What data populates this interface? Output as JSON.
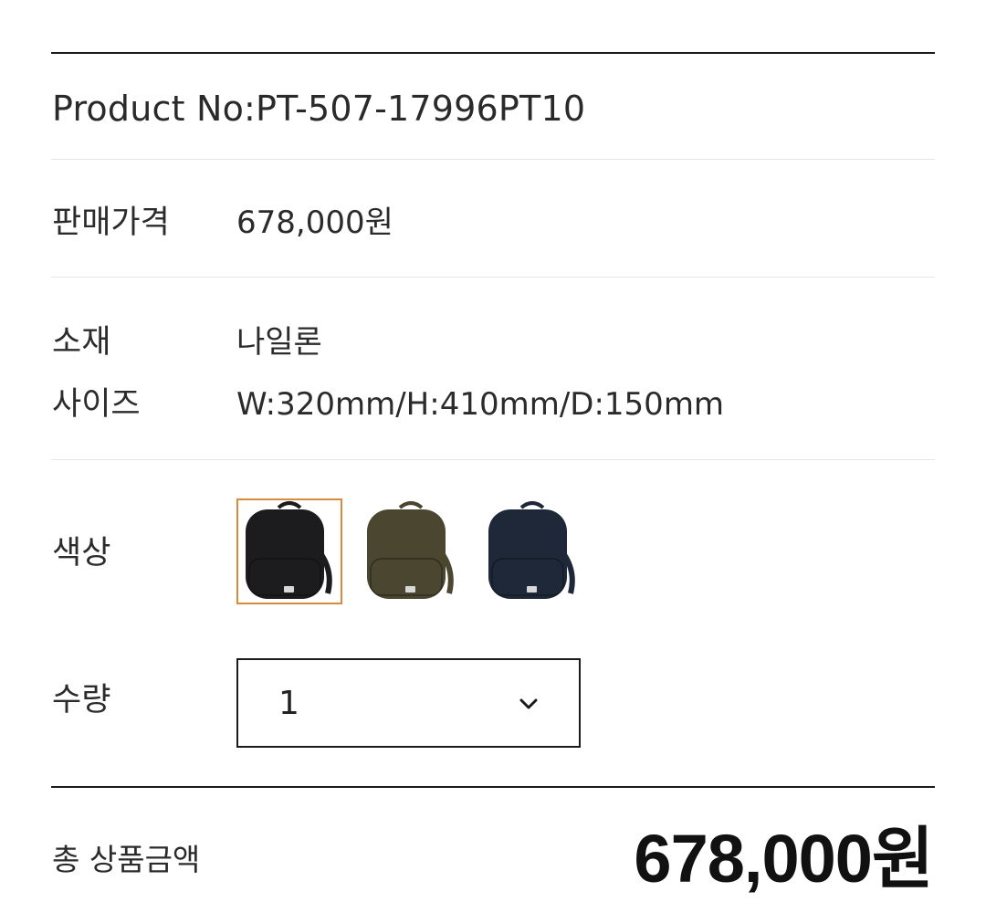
{
  "product": {
    "number_text": "Product No:PT-507-17996PT10"
  },
  "details": {
    "price_label": "판매가격",
    "price_value": "678,000원",
    "material_label": "소재",
    "material_value": "나일론",
    "size_label": "사이즈",
    "size_value": "W:320mm/H:410mm/D:150mm"
  },
  "color": {
    "label": "색상",
    "selected_index": 0,
    "selected_border_color": "#d98a3a",
    "options": [
      {
        "icon": "black-backpack-image",
        "body_color": "#1c1c1e"
      },
      {
        "icon": "olive-backpack-image",
        "body_color": "#4a4630"
      },
      {
        "icon": "navy-backpack-image",
        "body_color": "#1e2838"
      }
    ]
  },
  "quantity": {
    "label": "수량",
    "value": "1",
    "icon": "chevron-down-icon"
  },
  "total": {
    "label": "총 상품금액",
    "amount": "678,000원"
  }
}
